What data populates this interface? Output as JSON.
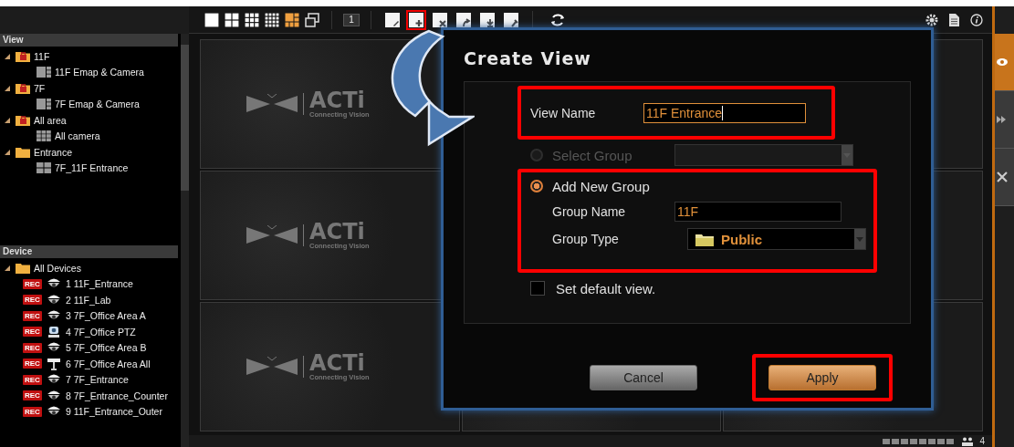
{
  "toolbar": {
    "layouts": [
      {
        "kind": "single",
        "selected": false
      },
      {
        "kind": "quad",
        "selected": false
      },
      {
        "kind": "nine",
        "selected": false
      },
      {
        "kind": "sixteen",
        "selected": false
      },
      {
        "kind": "custom",
        "selected": true
      },
      {
        "kind": "pip",
        "selected": false
      }
    ],
    "monitor": "1",
    "view_actions": [
      {
        "kind": "edit",
        "highlighted": false
      },
      {
        "kind": "add",
        "highlighted": true
      },
      {
        "kind": "delete",
        "highlighted": false
      },
      {
        "kind": "share",
        "highlighted": false
      },
      {
        "kind": "import",
        "highlighted": false
      },
      {
        "kind": "tools",
        "highlighted": false
      }
    ],
    "right_icons": [
      {
        "kind": "settings"
      },
      {
        "kind": "document"
      },
      {
        "kind": "info"
      }
    ]
  },
  "view_panel": {
    "title": "View",
    "items": [
      {
        "label": "11F",
        "kind": "locked",
        "expanded": true,
        "children": [
          {
            "label": "11F Emap & Camera",
            "kind": "emap"
          }
        ]
      },
      {
        "label": "7F",
        "kind": "locked",
        "expanded": true,
        "children": [
          {
            "label": "7F Emap & Camera",
            "kind": "emap"
          }
        ]
      },
      {
        "label": "All area",
        "kind": "locked",
        "expanded": true,
        "children": [
          {
            "label": "All camera",
            "kind": "grid"
          }
        ]
      },
      {
        "label": "Entrance",
        "kind": "folder",
        "expanded": true,
        "children": [
          {
            "label": "7F_11F Entrance",
            "kind": "quad"
          }
        ]
      }
    ]
  },
  "device_panel": {
    "title": "Device",
    "root": {
      "label": "All Devices",
      "expanded": true
    },
    "devices": [
      {
        "badge": "REC",
        "kind": "dome",
        "label": "1 11F_Entrance"
      },
      {
        "badge": "REC",
        "kind": "dome",
        "label": "2 11F_Lab"
      },
      {
        "badge": "REC",
        "kind": "dome",
        "label": "3 7F_Office Area A"
      },
      {
        "badge": "REC",
        "kind": "ptz",
        "label": "4 7F_Office PTZ"
      },
      {
        "badge": "REC",
        "kind": "dome",
        "label": "5 7F_Office Area B"
      },
      {
        "badge": "REC",
        "kind": "bullet",
        "label": "6 7F_Office Area All"
      },
      {
        "badge": "REC",
        "kind": "dome",
        "label": "7 7F_Entrance"
      },
      {
        "badge": "REC",
        "kind": "dome",
        "label": "8 7F_Entrance_Counter"
      },
      {
        "badge": "REC",
        "kind": "dome",
        "label": "9 11F_Entrance_Outer"
      }
    ]
  },
  "tiles": [
    {
      "logo": "ACTi",
      "tagline": "Connecting Vision"
    },
    {
      "logo": "ACTi",
      "tagline": "Connecting Vision"
    },
    {
      "logo": "ACTi",
      "tagline": "Connecting Vision"
    }
  ],
  "dialog": {
    "title": "Create View",
    "view_name": {
      "label": "View Name",
      "value": "11F Entrance",
      "focused": true,
      "highlighted": true
    },
    "select_group": {
      "label": "Select Group",
      "selected": false,
      "disabled": true
    },
    "add_group": {
      "label": "Add New Group",
      "selected": true,
      "disabled": false,
      "highlighted": true,
      "group_name": {
        "label": "Group Name",
        "value": "11F"
      },
      "group_type": {
        "label": "Group Type",
        "value": "Public"
      }
    },
    "default_view": {
      "label": "Set default view.",
      "checked": false
    },
    "buttons": [
      {
        "label": "Cancel",
        "kind": "secondary",
        "highlighted": false
      },
      {
        "label": "Apply",
        "kind": "primary",
        "highlighted": true
      }
    ]
  },
  "side_tabs": [
    {
      "kind": "eye",
      "selected": true
    },
    {
      "kind": "playback",
      "selected": false
    },
    {
      "kind": "tools",
      "selected": false
    }
  ],
  "status_bar": {
    "user_count": "4"
  }
}
